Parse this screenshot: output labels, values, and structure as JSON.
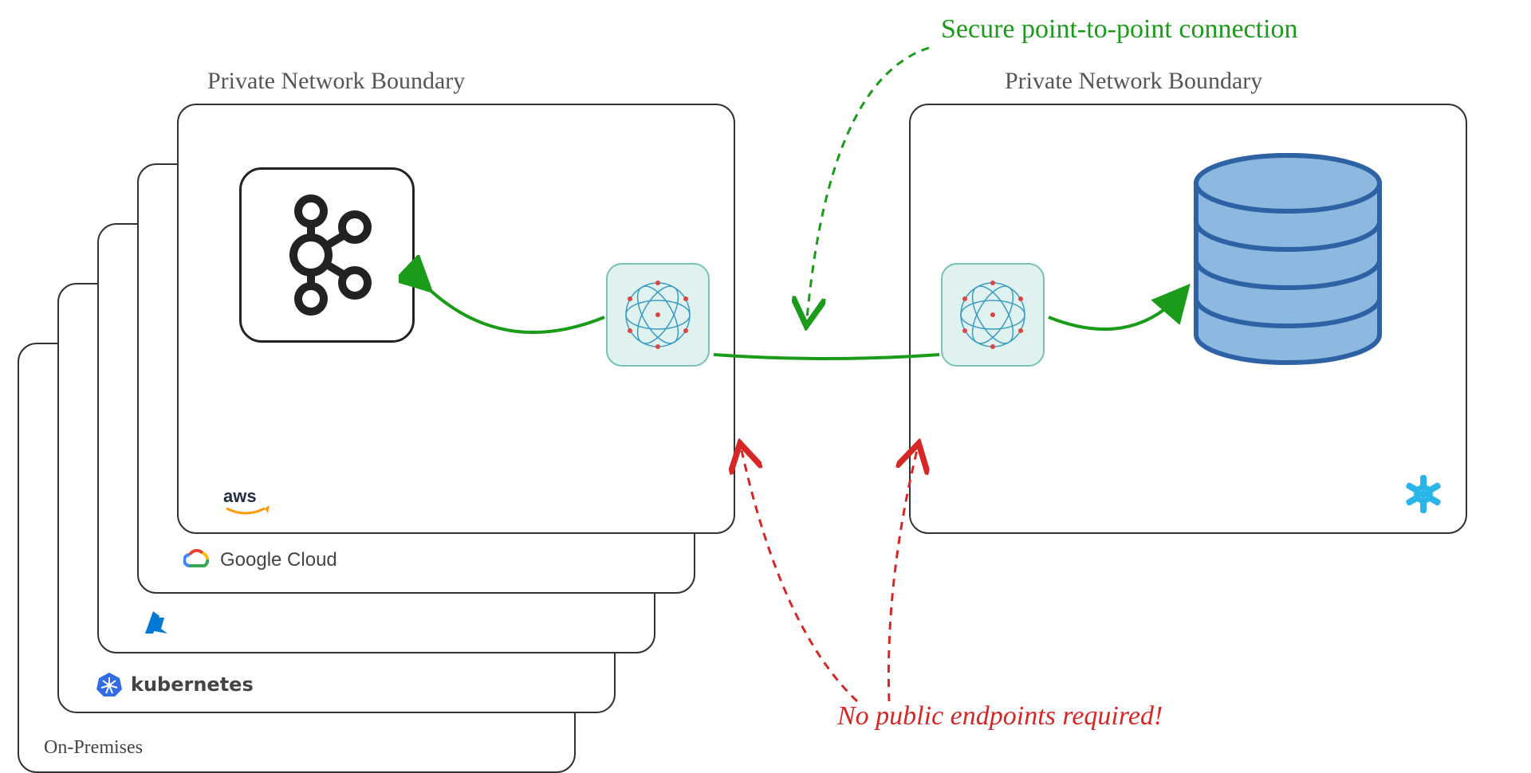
{
  "leftBoundaryLabel": "Private Network Boundary",
  "rightBoundaryLabel": "Private Network Boundary",
  "greenAnnotation": "Secure point-to-point connection",
  "redAnnotation": "No public endpoints required!",
  "providers": {
    "aws": "aws",
    "gcp": "Google Cloud",
    "azure": "",
    "k8s": "kubernetes",
    "onprem": "On-Premises"
  },
  "colors": {
    "green": "#1a9c1a",
    "red": "#d72626",
    "border": "#333333",
    "globeBg": "#e0f2ef",
    "globeBorder": "#78c2b5",
    "dbFill": "#8db8e0",
    "dbStroke": "#2d62a5",
    "snowflake": "#29b5e8",
    "gcpRed": "#ea4335",
    "gcpBlue": "#4285f4",
    "gcpYellow": "#fbbc04",
    "gcpGreen": "#34a853",
    "azureBlue": "#0078d4",
    "k8sBlue": "#326ce5",
    "awsText": "#232f3e",
    "awsSmile": "#ff9900"
  }
}
